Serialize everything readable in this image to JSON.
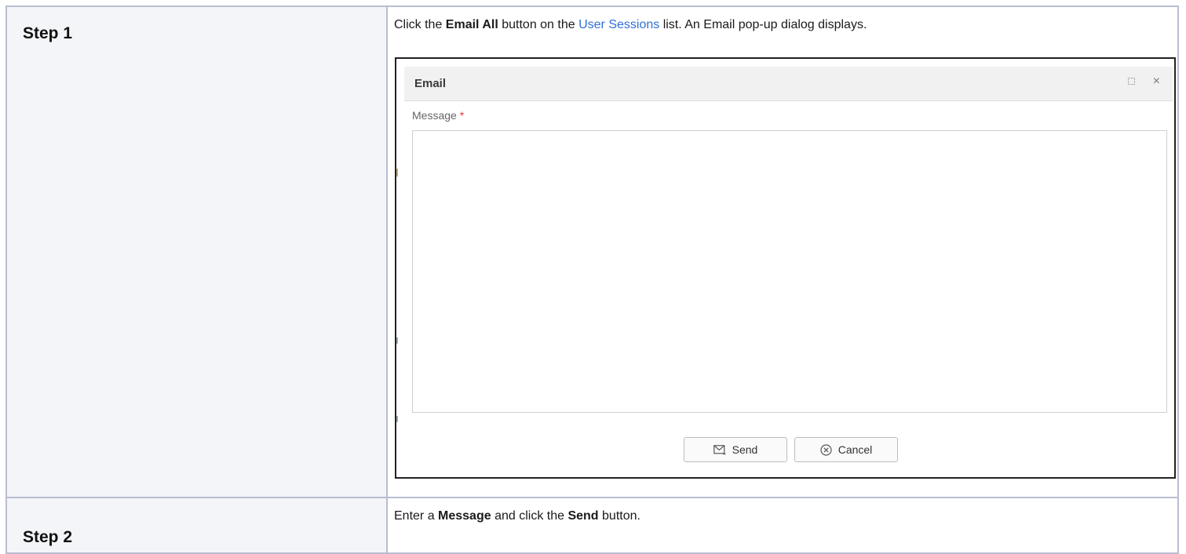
{
  "steps": [
    {
      "label": "Step 1",
      "instruction": {
        "pre": "Click the ",
        "bold1": "Email All",
        "mid": " button on the ",
        "link": "User Sessions",
        "post": " list. An Email pop-up dialog displays."
      }
    },
    {
      "label": "Step 2",
      "instruction": {
        "pre": "Enter a ",
        "bold1": "Message",
        "mid": " and click the ",
        "bold2": "Send",
        "post": " button."
      }
    }
  ],
  "dialog": {
    "title": "Email",
    "message_label": "Message",
    "required_marker": "*",
    "message_value": "",
    "send_label": "Send",
    "cancel_label": "Cancel",
    "icons": {
      "maximize": "maximize-icon",
      "close": "close-icon",
      "send": "send-mail-icon",
      "cancel": "cancel-circle-icon"
    }
  },
  "colors": {
    "link": "#2f6fd6",
    "required": "#e53935",
    "border": "#b9bdd0"
  }
}
